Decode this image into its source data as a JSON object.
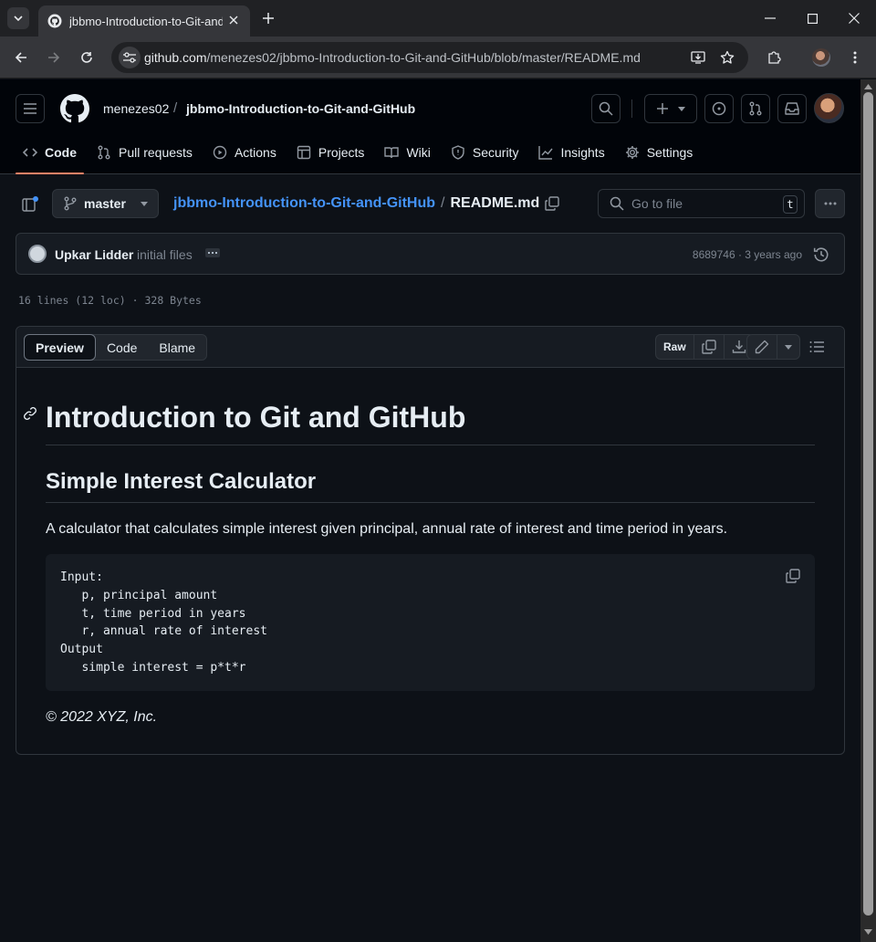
{
  "browser": {
    "tab_title": "jbbmo-Introduction-to-Git-and-GitHub",
    "url_host": "github.com",
    "url_path": "/menezes02/jbbmo-Introduction-to-Git-and-GitHub/blob/master/README.md"
  },
  "header": {
    "owner": "menezes02",
    "separator": "/",
    "repo": "jbbmo-Introduction-to-Git-and-GitHub"
  },
  "repo_nav": [
    {
      "label": "Code",
      "icon": "code-icon"
    },
    {
      "label": "Pull requests",
      "icon": "pull-request-icon"
    },
    {
      "label": "Actions",
      "icon": "play-icon"
    },
    {
      "label": "Projects",
      "icon": "table-icon"
    },
    {
      "label": "Wiki",
      "icon": "book-icon"
    },
    {
      "label": "Security",
      "icon": "shield-icon"
    },
    {
      "label": "Insights",
      "icon": "graph-icon"
    },
    {
      "label": "Settings",
      "icon": "gear-icon"
    }
  ],
  "file_header": {
    "branch": "master",
    "breadcrumb_repo": "jbbmo-Introduction-to-Git-and-GitHub",
    "breadcrumb_sep": "/",
    "breadcrumb_file": "README.md",
    "goto_placeholder": "Go to file",
    "goto_shortcut": "t"
  },
  "commit": {
    "author": "Upkar Lidder",
    "message": "initial files",
    "meta": "8689746 · 3 years ago"
  },
  "file_info": "16 lines (12 loc) · 328 Bytes",
  "view_tabs": [
    "Preview",
    "Code",
    "Blame"
  ],
  "raw_label": "Raw",
  "readme": {
    "h1": "Introduction to Git and GitHub",
    "h2": "Simple Interest Calculator",
    "paragraph": "A calculator that calculates simple interest given principal, annual rate of interest and time period in years.",
    "code_lines": [
      "Input:",
      "   p, principal amount",
      "   t, time period in years",
      "   r, annual rate of interest",
      "Output",
      "   simple interest = p*t*r"
    ],
    "footer": "© 2022 XYZ, Inc."
  },
  "colors": {
    "accent_link": "#4493f8",
    "active_underline": "#f78166",
    "bg": "#0d1117"
  }
}
